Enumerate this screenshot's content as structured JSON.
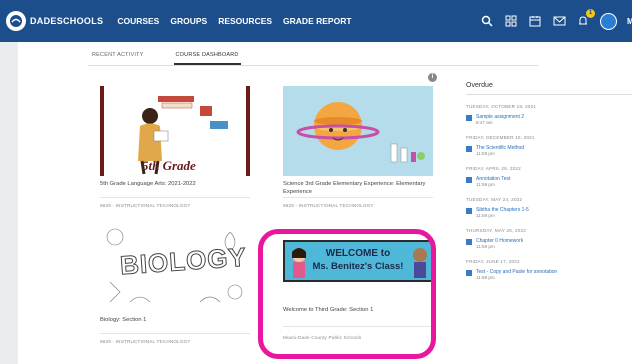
{
  "header": {
    "brand": "DADESCHOOLS",
    "nav": [
      "COURSES",
      "GROUPS",
      "RESOURCES",
      "GRADE REPORT"
    ],
    "notification_count": "1",
    "user_initial": "M"
  },
  "tabs": [
    "RECENT ACTIVITY",
    "COURSE DASHBOARD"
  ],
  "courses": [
    {
      "title": "5th Grade Language Arts: 2021-2022",
      "image_text": "5th Grade",
      "sub": "9629 - INSTRUCTIONAL TECHNOLOGY"
    },
    {
      "title": "Science 3rd Grade Elementary Experience: Elementary Experience",
      "sub": "9629 - INSTRUCTIONAL TECHNOLOGY"
    },
    {
      "title": "Biology: Section 1",
      "image_text": "BIOLOGY",
      "sub": "9629 - INSTRUCTIONAL TECHNOLOGY"
    },
    {
      "title": "Welcome to Third Grade: Section 1",
      "image_text_1": "WELCOME to",
      "image_text_2": "Ms. Benitez's Class!",
      "sub": "Miami-Dade County Public Schools"
    }
  ],
  "overdue": {
    "title": "Overdue",
    "groups": [
      {
        "date": "TUESDAY, OCTOBER 19, 2021",
        "name": "Sample assignment 2",
        "time": "8:47 am"
      },
      {
        "date": "FRIDAY, DECEMBER 10, 2021",
        "name": "The Scientific Method",
        "time": "11:59 pm"
      },
      {
        "date": "FRIDAY, APRIL 29, 2022",
        "name": "Annotation Test",
        "time": "11:59 pm"
      },
      {
        "date": "TUESDAY, MAY 24, 2022",
        "name": "Sibtha the Chapters 1-5",
        "time": "11:59 pm"
      },
      {
        "date": "THURSDAY, MAY 26, 2022",
        "name": "Chapter 0 Homework",
        "time": "11:59 pm"
      },
      {
        "date": "FRIDAY, JUNE 17, 2022",
        "name": "Test - Copy and Paste for annotation",
        "time": "11:59 pm"
      }
    ]
  },
  "colors": {
    "topbar": "#1d4e8c",
    "highlight": "#e9179e"
  }
}
